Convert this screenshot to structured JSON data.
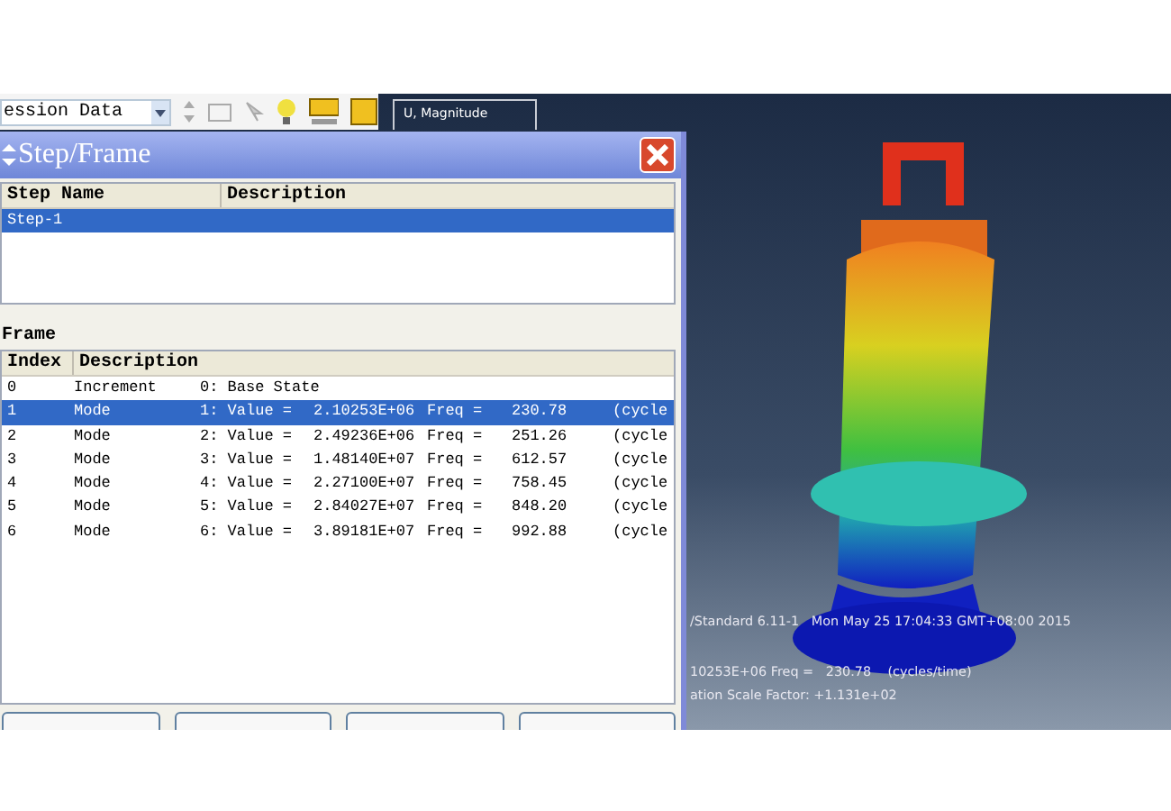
{
  "toolbar": {
    "combo_value": "ession Data"
  },
  "legend": {
    "title": "U, Magnitude"
  },
  "viewport_info": [
    "/Standard 6.11-1   Mon May 25 17:04:33 GMT+08:00 2015",
    "10253E+06 Freq =   230.78    (cycles/time)",
    "ation Scale Factor: +1.131e+02"
  ],
  "dialog": {
    "title": "Step/Frame",
    "step_table": {
      "columns": [
        "Step Name",
        "Description"
      ],
      "rows": [
        {
          "name": "Step-1",
          "selected": true
        }
      ]
    },
    "frame_label": "Frame",
    "frame_table": {
      "columns": [
        "Index",
        "Description"
      ],
      "rows": [
        {
          "index": "0",
          "type": "Increment",
          "parts": [
            "0: Base State"
          ],
          "selected": false
        },
        {
          "index": "1",
          "type": "Mode",
          "parts": [
            "1: Value =",
            "2.10253E+06",
            "Freq =",
            "230.78",
            "(cycle"
          ],
          "selected": true
        },
        {
          "index": "2",
          "type": "Mode",
          "parts": [
            "2: Value =",
            "2.49236E+06",
            "Freq =",
            "251.26",
            "(cycle"
          ],
          "selected": false
        },
        {
          "index": "3",
          "type": "Mode",
          "parts": [
            "3: Value =",
            "1.48140E+07",
            "Freq =",
            "612.57",
            "(cycle"
          ],
          "selected": false
        },
        {
          "index": "4",
          "type": "Mode",
          "parts": [
            "4: Value =",
            "2.27100E+07",
            "Freq =",
            "758.45",
            "(cycle"
          ],
          "selected": false
        },
        {
          "index": "5",
          "type": "Mode",
          "parts": [
            "5: Value =",
            "2.84027E+07",
            "Freq =",
            "848.20",
            "(cycle"
          ],
          "selected": false
        },
        {
          "index": "6",
          "type": "Mode",
          "parts": [
            "6: Value =",
            "3.89181E+07",
            "Freq =",
            "992.88",
            "(cycle"
          ],
          "selected": false
        }
      ]
    }
  }
}
